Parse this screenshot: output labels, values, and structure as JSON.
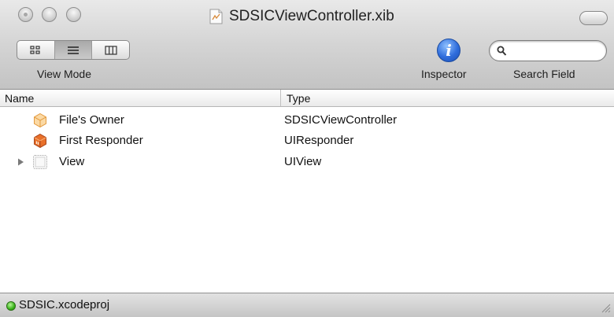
{
  "window": {
    "title": "SDSIC​ViewController.xib"
  },
  "toolbar": {
    "view_mode": {
      "label": "View Mode",
      "options": [
        "icons",
        "list",
        "columns"
      ],
      "selected": "list"
    },
    "inspector_label": "Inspector",
    "search_label": "Search Field",
    "search_value": ""
  },
  "columns": {
    "name": "Name",
    "type": "Type"
  },
  "rows": [
    {
      "name": "File's Owner",
      "type": "SDSICViewController",
      "icon": "files-owner-icon"
    },
    {
      "name": "First Responder",
      "type": "UIResponder",
      "icon": "first-responder-icon"
    },
    {
      "name": "View",
      "type": "UIView",
      "icon": "view-icon"
    }
  ],
  "status": {
    "project": "SDSIC.xcodeproj"
  }
}
